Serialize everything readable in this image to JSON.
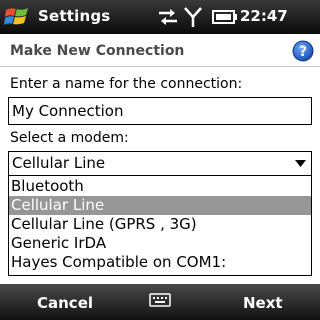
{
  "statusbar": {
    "title": "Settings",
    "time": "22:47",
    "icons": [
      "windows-start-icon",
      "sync-icon",
      "signal-icon",
      "battery-icon"
    ]
  },
  "header": {
    "title": "Make New Connection",
    "help_icon": "help-icon"
  },
  "form": {
    "name_label": "Enter a name for the connection:",
    "name_value": "My Connection",
    "modem_label": "Select a modem:",
    "modem_value": "Cellular Line",
    "modem_options": [
      "Bluetooth",
      "Cellular Line",
      "Cellular Line (GPRS , 3G)",
      "Generic IrDA",
      "Hayes Compatible on COM1:"
    ],
    "highlighted_option": "Cellular Line"
  },
  "softkeys": {
    "left": "Cancel",
    "right": "Next",
    "center_icon": "keyboard-icon"
  },
  "colors": {
    "highlight": "#969696",
    "help_blue": "#1f5fbf",
    "bar_dark": "#0a0a0a"
  }
}
